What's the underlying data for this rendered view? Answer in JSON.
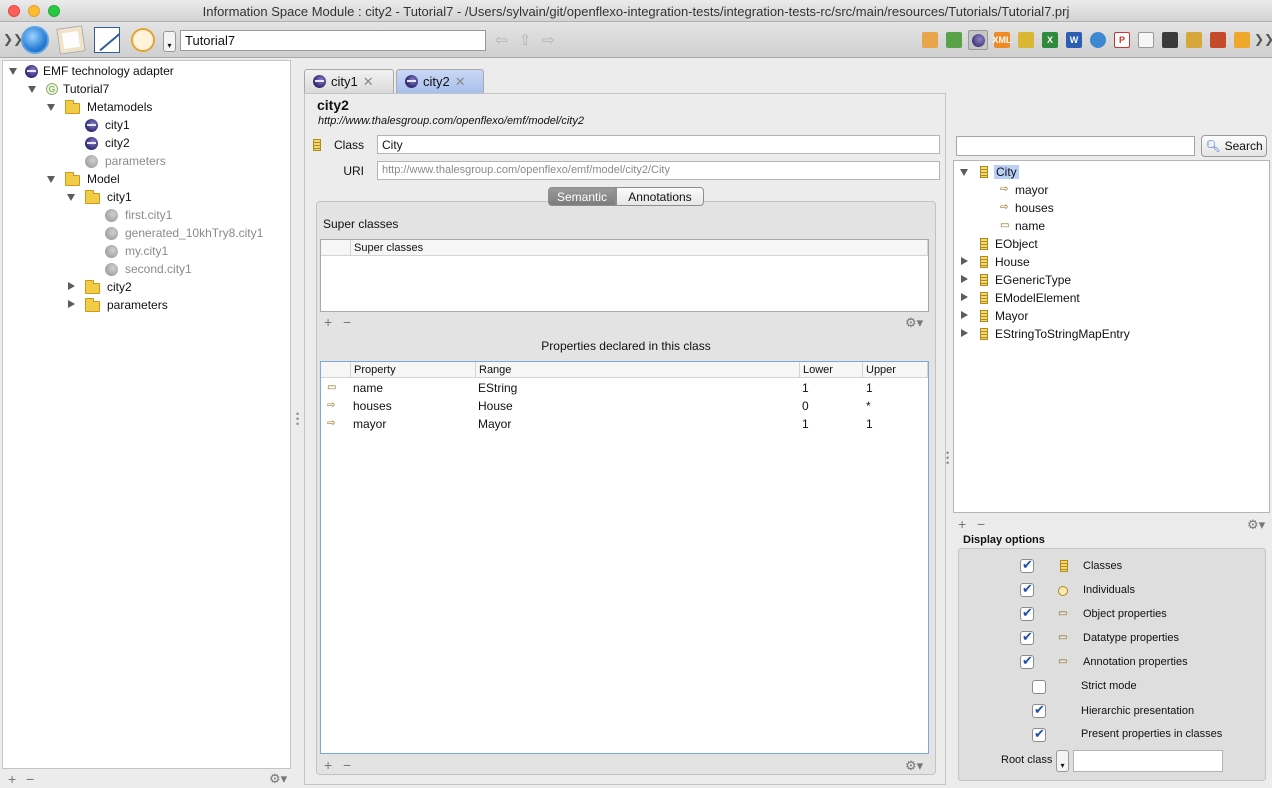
{
  "window": {
    "title": "Information Space Module : city2 - Tutorial7 - /Users/sylvain/git/openflexo-integration-tests/integration-tests-rc/src/main/resources/Tutorials/Tutorial7.prj"
  },
  "toolbar": {
    "project": "Tutorial7"
  },
  "left_tree": {
    "root": "EMF technology adapter",
    "project": "Tutorial7",
    "metamodels_folder": "Metamodels",
    "metamodels": [
      "city1",
      "city2",
      "parameters"
    ],
    "model_folder": "Model",
    "model_city1_folder": "city1",
    "city1_models": [
      "first.city1",
      "generated_10khTry8.city1",
      "my.city1",
      "second.city1"
    ],
    "model_city2_folder": "city2",
    "model_parameters_folder": "parameters"
  },
  "tabs": [
    {
      "label": "city1",
      "active": false
    },
    {
      "label": "city2",
      "active": true
    }
  ],
  "editor": {
    "heading": "city2",
    "uri_heading": "http://www.thalesgroup.com/openflexo/emf/model/city2",
    "class_label": "Class",
    "class_value": "City",
    "uri_label": "URI",
    "uri_value": "http://www.thalesgroup.com/openflexo/emf/model/city2/City",
    "seg_semantic": "Semantic",
    "seg_annotations": "Annotations",
    "super_classes_title": "Super classes",
    "super_classes_col": "Super classes",
    "properties_title": "Properties declared in this class",
    "columns": [
      "Property",
      "Range",
      "Lower",
      "Upper"
    ],
    "properties": [
      {
        "name": "name",
        "range": "EString",
        "lower": "1",
        "upper": "1"
      },
      {
        "name": "houses",
        "range": "House",
        "lower": "0",
        "upper": "*"
      },
      {
        "name": "mayor",
        "range": "Mayor",
        "lower": "1",
        "upper": "1"
      }
    ]
  },
  "right": {
    "search_placeholder": "",
    "search_button": "Search",
    "tree": {
      "city": "City",
      "city_children": [
        "mayor",
        "houses",
        "name"
      ],
      "others": [
        "EObject",
        "House",
        "EGenericType",
        "EModelElement",
        "Mayor",
        "EStringToStringMapEntry"
      ]
    },
    "display_options_title": "Display options",
    "options": [
      {
        "label": "Classes",
        "checked": true
      },
      {
        "label": "Individuals",
        "checked": true
      },
      {
        "label": "Object properties",
        "checked": true
      },
      {
        "label": "Datatype properties",
        "checked": true
      },
      {
        "label": "Annotation properties",
        "checked": true
      },
      {
        "label": "Strict mode",
        "checked": false
      },
      {
        "label": "Hierarchic presentation",
        "checked": true
      },
      {
        "label": "Present properties in classes",
        "checked": true
      }
    ],
    "root_class_label": "Root class",
    "root_class_value": ""
  },
  "icons": {
    "add": "+",
    "remove": "−",
    "gear": "⚙▾"
  },
  "colors": {
    "selection": "#b9cff5",
    "active_tab": "#a8c0ee",
    "checkbox_check": "#1d4ea8"
  }
}
